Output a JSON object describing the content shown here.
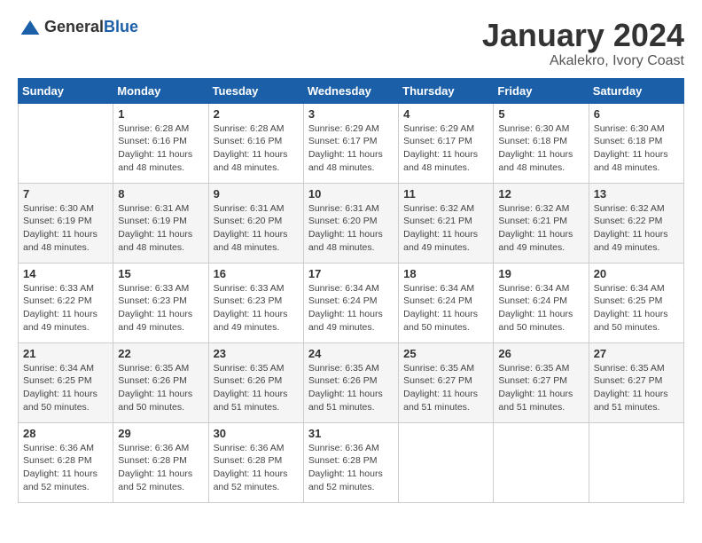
{
  "header": {
    "logo_general": "General",
    "logo_blue": "Blue",
    "month": "January 2024",
    "location": "Akalekro, Ivory Coast"
  },
  "days_of_week": [
    "Sunday",
    "Monday",
    "Tuesday",
    "Wednesday",
    "Thursday",
    "Friday",
    "Saturday"
  ],
  "weeks": [
    [
      {
        "day": "",
        "info": ""
      },
      {
        "day": "1",
        "info": "Sunrise: 6:28 AM\nSunset: 6:16 PM\nDaylight: 11 hours and 48 minutes."
      },
      {
        "day": "2",
        "info": "Sunrise: 6:28 AM\nSunset: 6:16 PM\nDaylight: 11 hours and 48 minutes."
      },
      {
        "day": "3",
        "info": "Sunrise: 6:29 AM\nSunset: 6:17 PM\nDaylight: 11 hours and 48 minutes."
      },
      {
        "day": "4",
        "info": "Sunrise: 6:29 AM\nSunset: 6:17 PM\nDaylight: 11 hours and 48 minutes."
      },
      {
        "day": "5",
        "info": "Sunrise: 6:30 AM\nSunset: 6:18 PM\nDaylight: 11 hours and 48 minutes."
      },
      {
        "day": "6",
        "info": "Sunrise: 6:30 AM\nSunset: 6:18 PM\nDaylight: 11 hours and 48 minutes."
      }
    ],
    [
      {
        "day": "7",
        "info": "Sunrise: 6:30 AM\nSunset: 6:19 PM\nDaylight: 11 hours and 48 minutes."
      },
      {
        "day": "8",
        "info": "Sunrise: 6:31 AM\nSunset: 6:19 PM\nDaylight: 11 hours and 48 minutes."
      },
      {
        "day": "9",
        "info": "Sunrise: 6:31 AM\nSunset: 6:20 PM\nDaylight: 11 hours and 48 minutes."
      },
      {
        "day": "10",
        "info": "Sunrise: 6:31 AM\nSunset: 6:20 PM\nDaylight: 11 hours and 48 minutes."
      },
      {
        "day": "11",
        "info": "Sunrise: 6:32 AM\nSunset: 6:21 PM\nDaylight: 11 hours and 49 minutes."
      },
      {
        "day": "12",
        "info": "Sunrise: 6:32 AM\nSunset: 6:21 PM\nDaylight: 11 hours and 49 minutes."
      },
      {
        "day": "13",
        "info": "Sunrise: 6:32 AM\nSunset: 6:22 PM\nDaylight: 11 hours and 49 minutes."
      }
    ],
    [
      {
        "day": "14",
        "info": "Sunrise: 6:33 AM\nSunset: 6:22 PM\nDaylight: 11 hours and 49 minutes."
      },
      {
        "day": "15",
        "info": "Sunrise: 6:33 AM\nSunset: 6:23 PM\nDaylight: 11 hours and 49 minutes."
      },
      {
        "day": "16",
        "info": "Sunrise: 6:33 AM\nSunset: 6:23 PM\nDaylight: 11 hours and 49 minutes."
      },
      {
        "day": "17",
        "info": "Sunrise: 6:34 AM\nSunset: 6:24 PM\nDaylight: 11 hours and 49 minutes."
      },
      {
        "day": "18",
        "info": "Sunrise: 6:34 AM\nSunset: 6:24 PM\nDaylight: 11 hours and 50 minutes."
      },
      {
        "day": "19",
        "info": "Sunrise: 6:34 AM\nSunset: 6:24 PM\nDaylight: 11 hours and 50 minutes."
      },
      {
        "day": "20",
        "info": "Sunrise: 6:34 AM\nSunset: 6:25 PM\nDaylight: 11 hours and 50 minutes."
      }
    ],
    [
      {
        "day": "21",
        "info": "Sunrise: 6:34 AM\nSunset: 6:25 PM\nDaylight: 11 hours and 50 minutes."
      },
      {
        "day": "22",
        "info": "Sunrise: 6:35 AM\nSunset: 6:26 PM\nDaylight: 11 hours and 50 minutes."
      },
      {
        "day": "23",
        "info": "Sunrise: 6:35 AM\nSunset: 6:26 PM\nDaylight: 11 hours and 51 minutes."
      },
      {
        "day": "24",
        "info": "Sunrise: 6:35 AM\nSunset: 6:26 PM\nDaylight: 11 hours and 51 minutes."
      },
      {
        "day": "25",
        "info": "Sunrise: 6:35 AM\nSunset: 6:27 PM\nDaylight: 11 hours and 51 minutes."
      },
      {
        "day": "26",
        "info": "Sunrise: 6:35 AM\nSunset: 6:27 PM\nDaylight: 11 hours and 51 minutes."
      },
      {
        "day": "27",
        "info": "Sunrise: 6:35 AM\nSunset: 6:27 PM\nDaylight: 11 hours and 51 minutes."
      }
    ],
    [
      {
        "day": "28",
        "info": "Sunrise: 6:36 AM\nSunset: 6:28 PM\nDaylight: 11 hours and 52 minutes."
      },
      {
        "day": "29",
        "info": "Sunrise: 6:36 AM\nSunset: 6:28 PM\nDaylight: 11 hours and 52 minutes."
      },
      {
        "day": "30",
        "info": "Sunrise: 6:36 AM\nSunset: 6:28 PM\nDaylight: 11 hours and 52 minutes."
      },
      {
        "day": "31",
        "info": "Sunrise: 6:36 AM\nSunset: 6:28 PM\nDaylight: 11 hours and 52 minutes."
      },
      {
        "day": "",
        "info": ""
      },
      {
        "day": "",
        "info": ""
      },
      {
        "day": "",
        "info": ""
      }
    ]
  ]
}
